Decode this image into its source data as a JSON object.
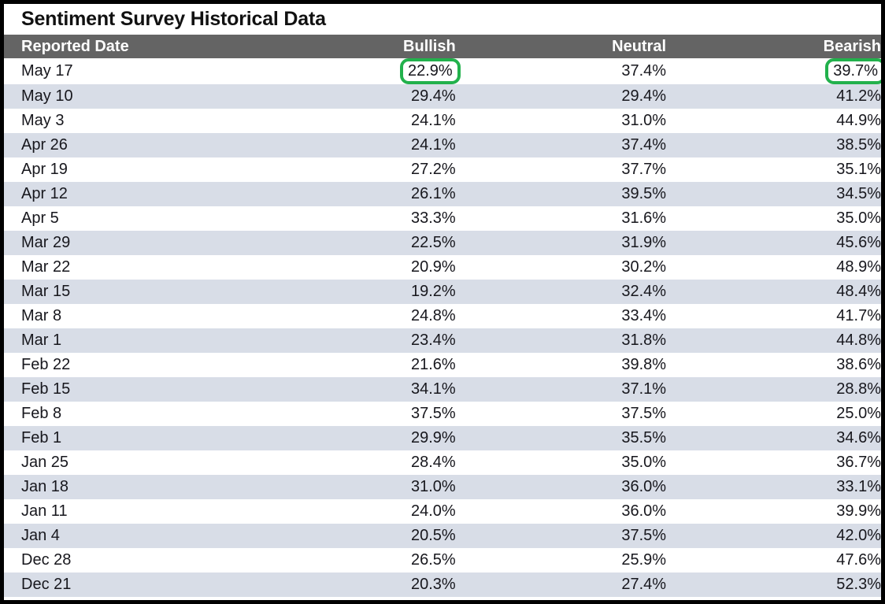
{
  "title": "Sentiment Survey Historical Data",
  "colors": {
    "header_band": "#646464",
    "row_alt": "#d8dde7",
    "highlight": "#22b14c",
    "frame": "#000000",
    "text": "#17171d"
  },
  "table": {
    "columns": [
      {
        "key": "date",
        "label": "Reported Date",
        "align": "left"
      },
      {
        "key": "bullish",
        "label": "Bullish",
        "align": "right"
      },
      {
        "key": "neutral",
        "label": "Neutral",
        "align": "right"
      },
      {
        "key": "bearish",
        "label": "Bearish",
        "align": "right"
      }
    ],
    "rows": [
      {
        "date": "May 17",
        "bullish": "22.9%",
        "neutral": "37.4%",
        "bearish": "39.7%",
        "highlight": [
          "bullish",
          "bearish"
        ]
      },
      {
        "date": "May 10",
        "bullish": "29.4%",
        "neutral": "29.4%",
        "bearish": "41.2%",
        "highlight": []
      },
      {
        "date": "May 3",
        "bullish": "24.1%",
        "neutral": "31.0%",
        "bearish": "44.9%",
        "highlight": []
      },
      {
        "date": "Apr 26",
        "bullish": "24.1%",
        "neutral": "37.4%",
        "bearish": "38.5%",
        "highlight": []
      },
      {
        "date": "Apr 19",
        "bullish": "27.2%",
        "neutral": "37.7%",
        "bearish": "35.1%",
        "highlight": []
      },
      {
        "date": "Apr 12",
        "bullish": "26.1%",
        "neutral": "39.5%",
        "bearish": "34.5%",
        "highlight": []
      },
      {
        "date": "Apr 5",
        "bullish": "33.3%",
        "neutral": "31.6%",
        "bearish": "35.0%",
        "highlight": []
      },
      {
        "date": "Mar 29",
        "bullish": "22.5%",
        "neutral": "31.9%",
        "bearish": "45.6%",
        "highlight": []
      },
      {
        "date": "Mar 22",
        "bullish": "20.9%",
        "neutral": "30.2%",
        "bearish": "48.9%",
        "highlight": []
      },
      {
        "date": "Mar 15",
        "bullish": "19.2%",
        "neutral": "32.4%",
        "bearish": "48.4%",
        "highlight": []
      },
      {
        "date": "Mar 8",
        "bullish": "24.8%",
        "neutral": "33.4%",
        "bearish": "41.7%",
        "highlight": []
      },
      {
        "date": "Mar 1",
        "bullish": "23.4%",
        "neutral": "31.8%",
        "bearish": "44.8%",
        "highlight": []
      },
      {
        "date": "Feb 22",
        "bullish": "21.6%",
        "neutral": "39.8%",
        "bearish": "38.6%",
        "highlight": []
      },
      {
        "date": "Feb 15",
        "bullish": "34.1%",
        "neutral": "37.1%",
        "bearish": "28.8%",
        "highlight": []
      },
      {
        "date": "Feb 8",
        "bullish": "37.5%",
        "neutral": "37.5%",
        "bearish": "25.0%",
        "highlight": []
      },
      {
        "date": "Feb 1",
        "bullish": "29.9%",
        "neutral": "35.5%",
        "bearish": "34.6%",
        "highlight": []
      },
      {
        "date": "Jan 25",
        "bullish": "28.4%",
        "neutral": "35.0%",
        "bearish": "36.7%",
        "highlight": []
      },
      {
        "date": "Jan 18",
        "bullish": "31.0%",
        "neutral": "36.0%",
        "bearish": "33.1%",
        "highlight": []
      },
      {
        "date": "Jan 11",
        "bullish": "24.0%",
        "neutral": "36.0%",
        "bearish": "39.9%",
        "highlight": []
      },
      {
        "date": "Jan 4",
        "bullish": "20.5%",
        "neutral": "37.5%",
        "bearish": "42.0%",
        "highlight": []
      },
      {
        "date": "Dec 28",
        "bullish": "26.5%",
        "neutral": "25.9%",
        "bearish": "47.6%",
        "highlight": []
      },
      {
        "date": "Dec 21",
        "bullish": "20.3%",
        "neutral": "27.4%",
        "bearish": "52.3%",
        "highlight": []
      }
    ]
  },
  "chart_data": {
    "type": "table",
    "title": "Sentiment Survey Historical Data",
    "columns": [
      "Reported Date",
      "Bullish",
      "Neutral",
      "Bearish"
    ],
    "categories": [
      "May 17",
      "May 10",
      "May 3",
      "Apr 26",
      "Apr 19",
      "Apr 12",
      "Apr 5",
      "Mar 29",
      "Mar 22",
      "Mar 15",
      "Mar 8",
      "Mar 1",
      "Feb 22",
      "Feb 15",
      "Feb 8",
      "Feb 1",
      "Jan 25",
      "Jan 18",
      "Jan 11",
      "Jan 4",
      "Dec 28",
      "Dec 21"
    ],
    "series": [
      {
        "name": "Bullish",
        "values": [
          22.9,
          29.4,
          24.1,
          24.1,
          27.2,
          26.1,
          33.3,
          22.5,
          20.9,
          19.2,
          24.8,
          23.4,
          21.6,
          34.1,
          37.5,
          29.9,
          28.4,
          31.0,
          24.0,
          20.5,
          26.5,
          20.3
        ]
      },
      {
        "name": "Neutral",
        "values": [
          37.4,
          29.4,
          31.0,
          37.4,
          37.7,
          39.5,
          31.6,
          31.9,
          30.2,
          32.4,
          33.4,
          31.8,
          39.8,
          37.1,
          37.5,
          35.5,
          35.0,
          36.0,
          36.0,
          37.5,
          25.9,
          27.4
        ]
      },
      {
        "name": "Bearish",
        "values": [
          39.7,
          41.2,
          44.9,
          38.5,
          35.1,
          34.5,
          35.0,
          45.6,
          48.9,
          48.4,
          41.7,
          44.8,
          38.6,
          28.8,
          25.0,
          34.6,
          36.7,
          33.1,
          39.9,
          42.0,
          47.6,
          52.3
        ]
      }
    ],
    "units": "percent",
    "annotations": [
      {
        "row": "May 17",
        "column": "Bullish",
        "value": 22.9,
        "style": "green-rounded-outline"
      },
      {
        "row": "May 17",
        "column": "Bearish",
        "value": 39.7,
        "style": "green-rounded-outline"
      }
    ]
  }
}
